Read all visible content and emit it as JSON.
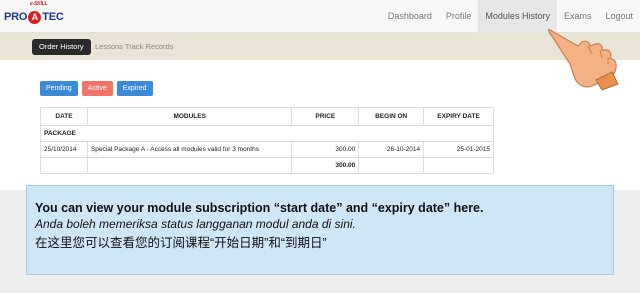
{
  "logo": {
    "brand_pro": "PRO",
    "brand_a": "A",
    "brand_tec": "TEC",
    "brand_tag": "e-SKILL"
  },
  "nav": {
    "items": [
      {
        "label": "Dashboard"
      },
      {
        "label": "Profile"
      },
      {
        "label": "Modules History"
      },
      {
        "label": "Exams"
      },
      {
        "label": "Logout"
      }
    ],
    "active_index": 2
  },
  "subnav": {
    "order_history": "Order History",
    "lessons_track": "Lessons Track Records"
  },
  "filters": {
    "pending": "Pending",
    "active": "Active",
    "expired": "Expired"
  },
  "table": {
    "headers": {
      "date": "DATE",
      "modules": "MODULES",
      "price": "PRICE",
      "begin_on": "BEGIN ON",
      "expiry_date": "EXPIRY DATE"
    },
    "section_label": "PACKAGE",
    "row": {
      "date": "25/10/2014",
      "module": "Special Package A - Access all modules valid for 3 months",
      "price": "300.00",
      "begin_on": "26-10-2014",
      "expiry_date": "25-01-2015"
    },
    "total": "300.00"
  },
  "caption": {
    "english": "You can view your module subscription “start date” and “expiry date” here.",
    "malay": "Anda boleh memeriksa status langganan modul anda di sini.",
    "chinese": "在这里您可以查看您的订阅课程“开始日期”和“到期日”"
  },
  "colors": {
    "accent_blue": "#3a8ad6",
    "accent_red": "#f0746a",
    "caption_bg": "#cfe6f7",
    "subnav_bg": "#eae4d6",
    "hand": "#f4b183"
  }
}
